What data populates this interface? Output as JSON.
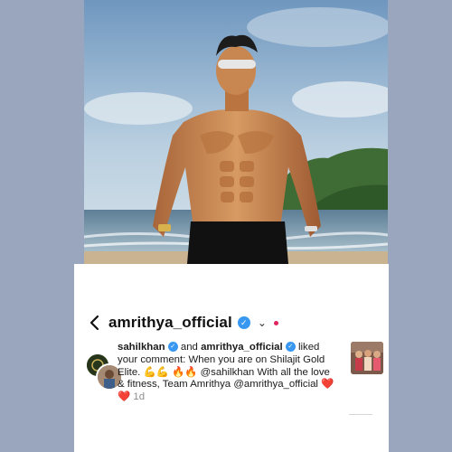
{
  "header": {
    "username": "amrithya_official",
    "back_icon": "chevron-left-icon",
    "dropdown_icon": "chevron-down-icon"
  },
  "notification": {
    "user1": "sahilkhan",
    "connector": "and",
    "user2": "amrithya_official",
    "action": "liked your comment: When you are on Shilajit Gold Elite.",
    "emojis": "💪💪 🔥🔥",
    "mention": "@sahilkhan",
    "message": "With all the love & fitness, Team Amrithya",
    "mention2": "@amrithya_official",
    "hearts": "❤️❤️",
    "timestamp": "1d"
  },
  "colors": {
    "verified": "#3897f0",
    "notification_dot": "#e0245e",
    "background": "#9aa6bd"
  }
}
